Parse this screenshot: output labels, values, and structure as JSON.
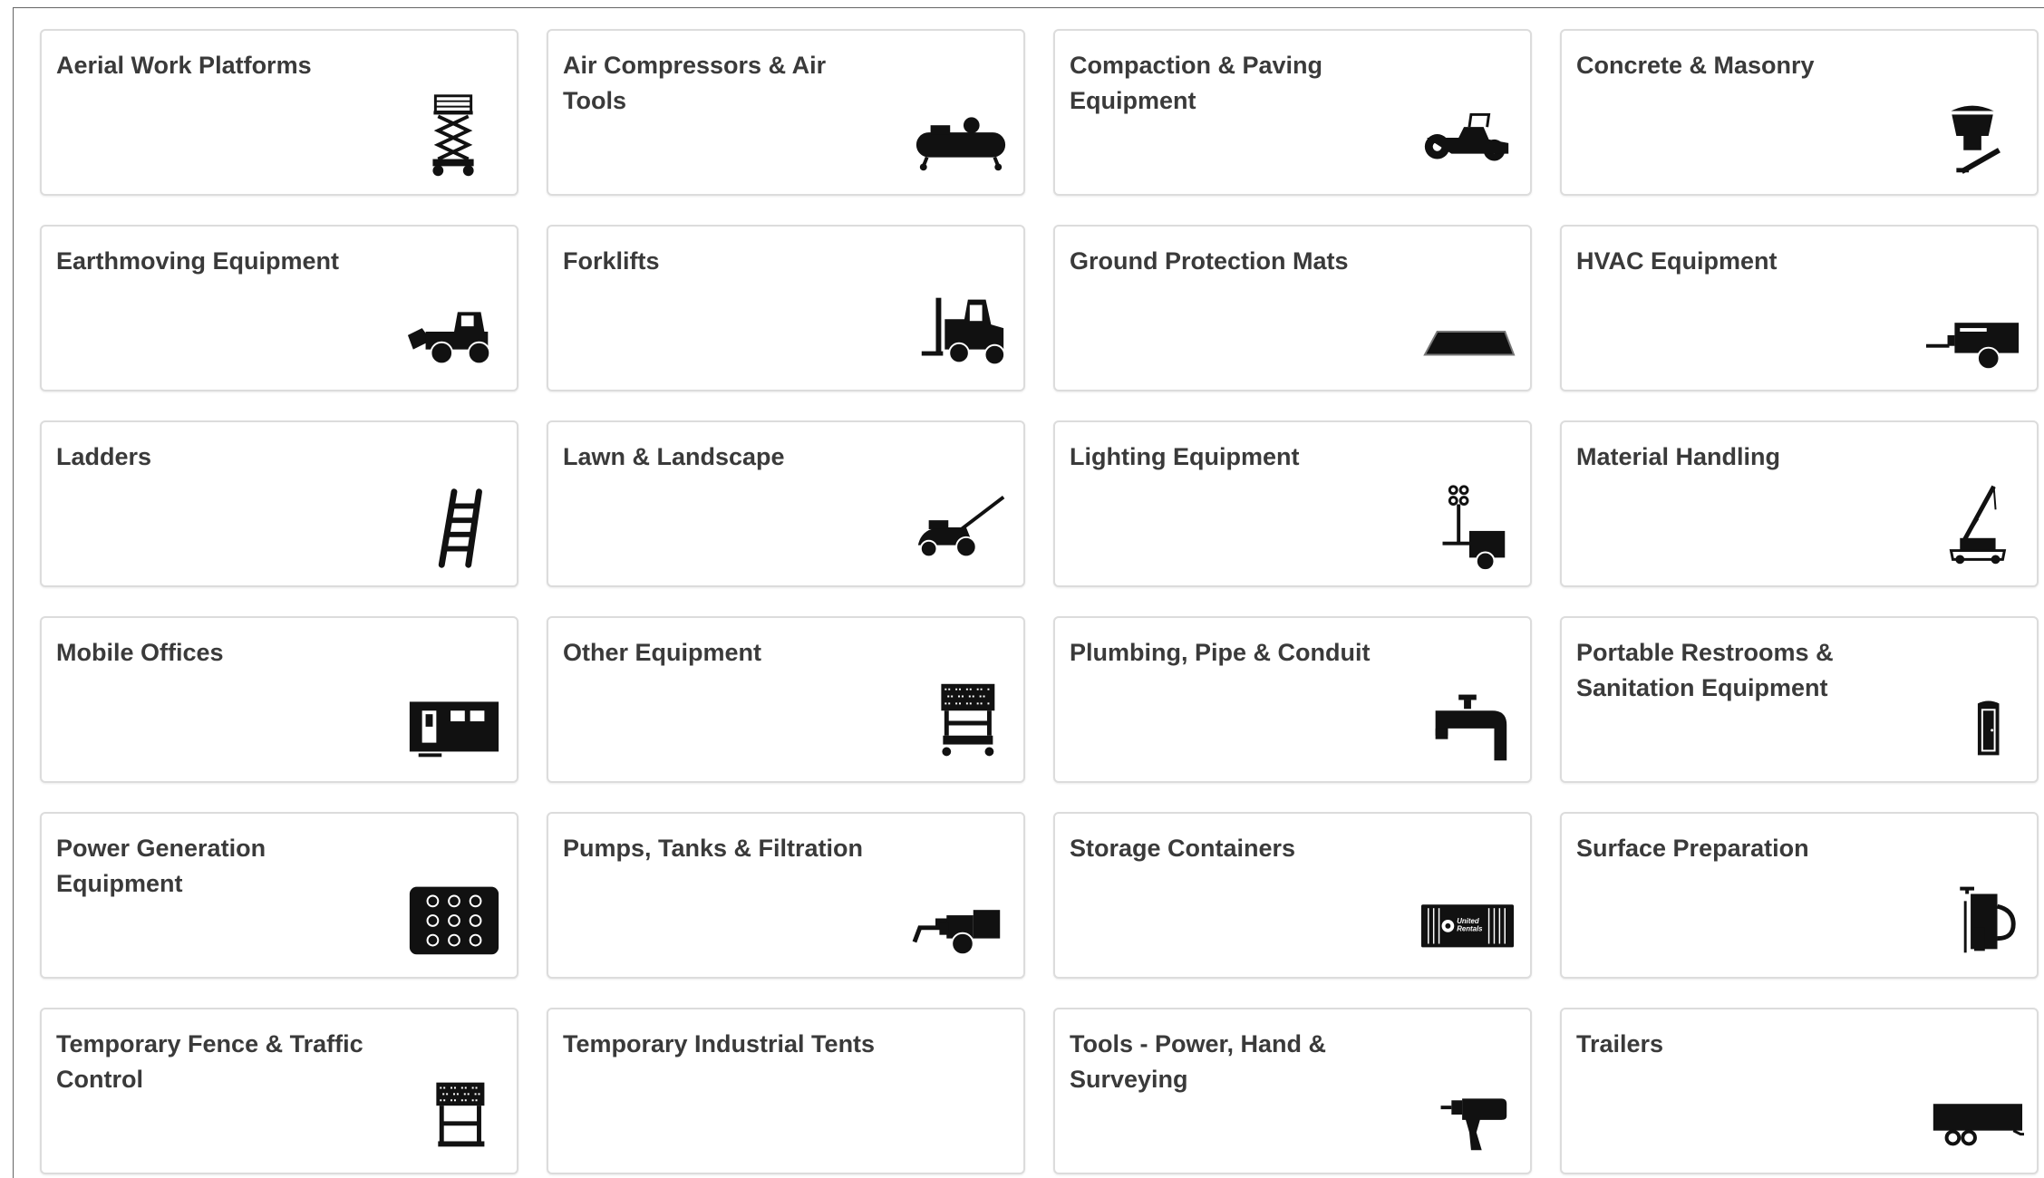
{
  "categories": [
    {
      "title": "Aerial Work Platforms",
      "icon": "scissor-lift-icon"
    },
    {
      "title": "Air Compressors & Air Tools",
      "icon": "air-compressor-icon"
    },
    {
      "title": "Compaction & Paving Equipment",
      "icon": "roller-icon"
    },
    {
      "title": "Concrete & Masonry",
      "icon": "concrete-hopper-icon"
    },
    {
      "title": "Earthmoving Equipment",
      "icon": "wheel-loader-icon"
    },
    {
      "title": "Forklifts",
      "icon": "forklift-icon"
    },
    {
      "title": "Ground Protection Mats",
      "icon": "ground-mat-icon"
    },
    {
      "title": "HVAC Equipment",
      "icon": "hvac-trailer-icon"
    },
    {
      "title": "Ladders",
      "icon": "ladder-icon"
    },
    {
      "title": "Lawn & Landscape",
      "icon": "lawn-mower-icon"
    },
    {
      "title": "Lighting Equipment",
      "icon": "light-tower-icon"
    },
    {
      "title": "Material Handling",
      "icon": "telehandler-icon"
    },
    {
      "title": "Mobile Offices",
      "icon": "mobile-office-icon"
    },
    {
      "title": "Other Equipment",
      "icon": "arrow-board-icon"
    },
    {
      "title": "Plumbing, Pipe & Conduit",
      "icon": "faucet-icon"
    },
    {
      "title": "Portable Restrooms & Sanitation Equipment",
      "icon": "portable-restroom-icon"
    },
    {
      "title": "Power Generation Equipment",
      "icon": "generator-icon"
    },
    {
      "title": "Pumps, Tanks & Filtration",
      "icon": "pump-icon"
    },
    {
      "title": "Storage Containers",
      "icon": "storage-container-icon"
    },
    {
      "title": "Surface Preparation",
      "icon": "surface-prep-icon"
    },
    {
      "title": "Temporary Fence & Traffic Control",
      "icon": "traffic-sign-icon"
    },
    {
      "title": "Temporary Industrial Tents",
      "icon": ""
    },
    {
      "title": "Tools - Power, Hand & Surveying",
      "icon": "power-drill-icon"
    },
    {
      "title": "Trailers",
      "icon": "trailer-icon"
    }
  ],
  "container_logo_text": "United Rentals",
  "colors": {
    "card_border": "#dcdcdc",
    "title_text": "#3a3a3a",
    "icon_fill": "#111111"
  }
}
